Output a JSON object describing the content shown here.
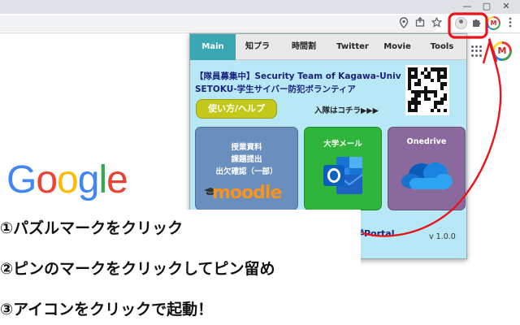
{
  "browser": {
    "window_controls": [
      "—",
      "▢",
      "✕"
    ]
  },
  "google": {
    "logo_letters": [
      {
        "char": "G",
        "color": "#4285F4"
      },
      {
        "char": "o",
        "color": "#EA4335"
      },
      {
        "char": "o",
        "color": "#FBBC05"
      },
      {
        "char": "g",
        "color": "#4285F4"
      },
      {
        "char": "l",
        "color": "#34A853"
      },
      {
        "char": "e",
        "color": "#EA4335"
      }
    ]
  },
  "avatar_letter": "M",
  "popup": {
    "tabs": [
      {
        "label": "Main",
        "active": true
      },
      {
        "label": "知プラ"
      },
      {
        "label": "時間割"
      },
      {
        "label": "Twitter"
      },
      {
        "label": "Movie"
      },
      {
        "label": "Tools"
      }
    ],
    "banner_title": "【隊員募集中】Security Team of Kagawa-Univ",
    "banner_subtitle": "SETOKU-学生サイバー防犯ボランティア",
    "help_button": "使い方/ヘルプ",
    "join_text": "入隊はコチラ▶▶▶",
    "tiles": {
      "moodle": {
        "lines": [
          "授業資料",
          "課題提出",
          "出欠確認（一部）"
        ],
        "logo": "moodle"
      },
      "mail": {
        "label": "大学メール"
      },
      "onedrive": {
        "label": "Onedrive"
      }
    },
    "portal_fragment": "学Portal",
    "version": "v 1.0.0"
  },
  "instructions": [
    "①パズルマークをクリック",
    "②ピンのマークをクリックしてピン留め",
    "③アイコンをクリックで起動！"
  ],
  "colors": {
    "popup_bg": "#b8e8f5",
    "active_tab": "#3aa7b3",
    "annotation_red": "#e8141c"
  }
}
